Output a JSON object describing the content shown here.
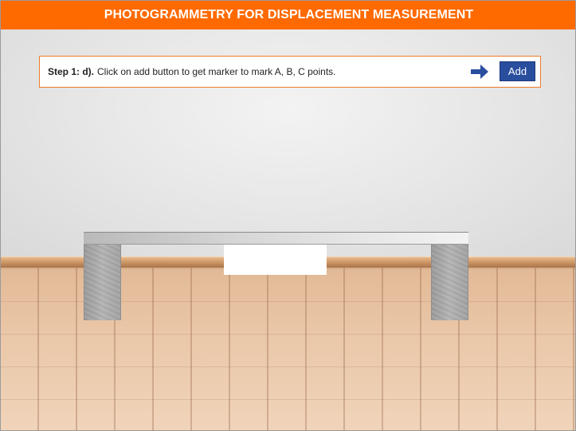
{
  "header": {
    "title": "PHOTOGRAMMETRY FOR DISPLACEMENT MEASUREMENT",
    "background_color": "#ff6a00"
  },
  "instruction": {
    "step_label": "Step 1: d).",
    "text": "Click on add button to get marker to mark A, B, C points.",
    "border_color": "#f07a2a"
  },
  "controls": {
    "arrow_icon": "arrow-right-icon",
    "add_label": "Add",
    "add_color": "#2a4e9e"
  },
  "scene": {
    "objects": [
      "beam",
      "left-support",
      "right-support",
      "white-placeholder"
    ]
  }
}
